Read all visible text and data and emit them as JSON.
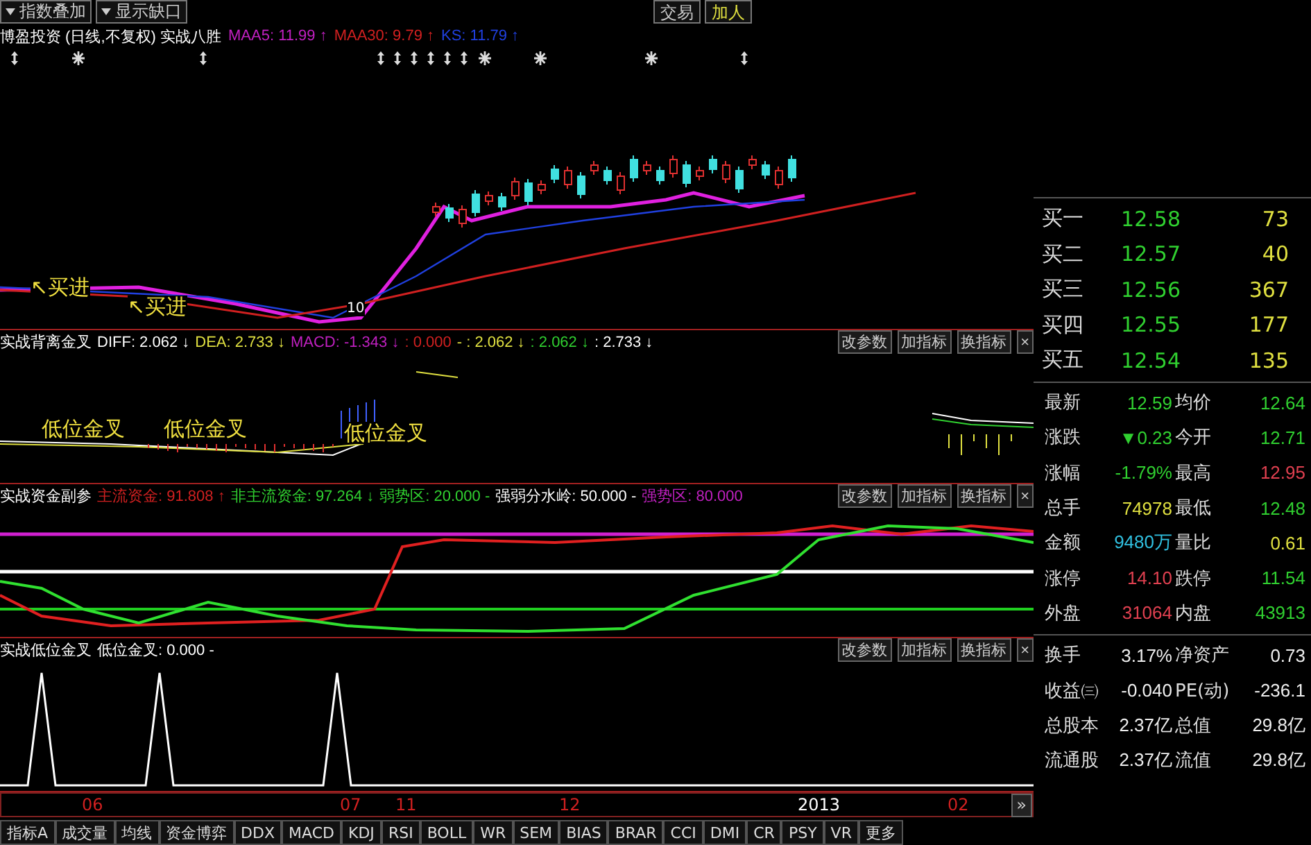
{
  "toolbar": {
    "dropdowns": [
      "指数叠加",
      "显示缺口"
    ],
    "buttons": [
      "交易",
      "加人"
    ]
  },
  "main_chart": {
    "title": "博盈投资 (日线,不复权) 实战八胜",
    "readings": [
      {
        "text": "MAA5: 11.99 ↑",
        "color": "#c020c0"
      },
      {
        "text": "MAA30: 9.79 ↑",
        "color": "#d02020"
      },
      {
        "text": "KS: 11.79 ↑",
        "color": "#2040e0"
      }
    ],
    "annotations": [
      "↖买进",
      "↖买进",
      "10"
    ]
  },
  "panes": [
    {
      "kind": "macd",
      "title": "实战背离金叉",
      "readings": [
        {
          "text": "DIFF: 2.062 ↓",
          "color": "#ffffff"
        },
        {
          "text": "DEA: 2.733 ↓",
          "color": "#e0e040"
        },
        {
          "text": "MACD: -1.343 ↓",
          "color": "#c020c0"
        },
        {
          "text": ": 0.000",
          "color": "#d02020"
        },
        {
          "text": "- : 2.062 ↓",
          "color": "#e0e040"
        },
        {
          "text": ": 2.062 ↓",
          "color": "#30d030"
        },
        {
          "text": ": 2.733 ↓",
          "color": "#ffffff"
        }
      ],
      "annotations": [
        "低位金叉",
        "低位金叉",
        "低位金叉"
      ],
      "buttons": [
        "改参数",
        "加指标",
        "换指标",
        "×"
      ]
    },
    {
      "kind": "fund",
      "title": "实战资金副参",
      "readings": [
        {
          "text": "主流资金: 91.808 ↑",
          "color": "#d02020"
        },
        {
          "text": "非主流资金: 97.264 ↓",
          "color": "#30d030"
        },
        {
          "text": "弱势区: 20.000 -",
          "color": "#30d030"
        },
        {
          "text": "强弱分水岭: 50.000 -",
          "color": "#ffffff"
        },
        {
          "text": "强势区: 80.000",
          "color": "#c020c0"
        }
      ],
      "buttons": [
        "改参数",
        "加指标",
        "换指标",
        "×"
      ]
    },
    {
      "kind": "spike",
      "title": "实战低位金叉",
      "readings": [
        {
          "text": "低位金叉: 0.000 -",
          "color": "#ffffff"
        }
      ],
      "buttons": [
        "改参数",
        "加指标",
        "换指标",
        "×"
      ]
    }
  ],
  "x_axis": {
    "labels": [
      {
        "text": "06",
        "color": "#d02020"
      },
      {
        "text": "07",
        "color": "#d02020"
      },
      {
        "text": "11",
        "color": "#d02020"
      },
      {
        "text": "12",
        "color": "#d02020"
      },
      {
        "text": "2013",
        "color": "#ffffff"
      },
      {
        "text": "02",
        "color": "#d02020"
      }
    ],
    "more": "»"
  },
  "quote": {
    "bids": [
      {
        "label": "买一",
        "price": "12.58",
        "volume": "73"
      },
      {
        "label": "买二",
        "price": "12.57",
        "volume": "40"
      },
      {
        "label": "买三",
        "price": "12.56",
        "volume": "367"
      },
      {
        "label": "买四",
        "price": "12.55",
        "volume": "177"
      },
      {
        "label": "买五",
        "price": "12.54",
        "volume": "135"
      }
    ],
    "stats": [
      {
        "label": "最新",
        "value": "12.59",
        "color": "#30d030"
      },
      {
        "label": "均价",
        "value": "12.64",
        "color": "#30d030"
      },
      {
        "label": "涨跌",
        "value": "▼0.23",
        "color": "#30d030"
      },
      {
        "label": "今开",
        "value": "12.71",
        "color": "#30d030"
      },
      {
        "label": "涨幅",
        "value": "-1.79%",
        "color": "#30d030"
      },
      {
        "label": "最高",
        "value": "12.95",
        "color": "#e04050"
      },
      {
        "label": "总手",
        "value": "74978",
        "color": "#e0e040"
      },
      {
        "label": "最低",
        "value": "12.48",
        "color": "#30d030"
      },
      {
        "label": "金额",
        "value": "9480万",
        "color": "#30c0e0"
      },
      {
        "label": "量比",
        "value": "0.61",
        "color": "#e0e040"
      },
      {
        "label": "涨停",
        "value": "14.10",
        "color": "#e04050"
      },
      {
        "label": "跌停",
        "value": "11.54",
        "color": "#30d030"
      },
      {
        "label": "外盘",
        "value": "31064",
        "color": "#e04050"
      },
      {
        "label": "内盘",
        "value": "43913",
        "color": "#30d030"
      }
    ],
    "fundamentals": [
      {
        "label": "换手",
        "value": "3.17%"
      },
      {
        "label": "净资产",
        "value": "0.73"
      },
      {
        "label": "收益㈢",
        "value": "-0.040"
      },
      {
        "label": "PE(动)",
        "value": "-236.1"
      },
      {
        "label": "总股本",
        "value": "2.37亿"
      },
      {
        "label": "总值",
        "value": "29.8亿"
      },
      {
        "label": "流通股",
        "value": "2.37亿"
      },
      {
        "label": "流值",
        "value": "29.8亿"
      }
    ]
  },
  "tabs": [
    "指标A",
    "成交量",
    "均线",
    "资金博弈",
    "DDX",
    "MACD",
    "KDJ",
    "RSI",
    "BOLL",
    "WR",
    "SEM",
    "BIAS",
    "BRAR",
    "CCI",
    "DMI",
    "CR",
    "PSY",
    "VR",
    "更多"
  ]
}
